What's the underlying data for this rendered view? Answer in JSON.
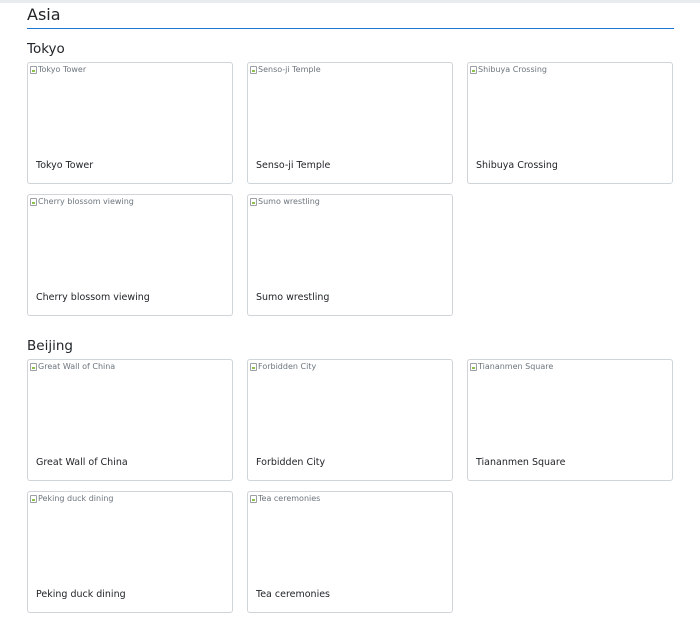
{
  "region": "Asia",
  "cities": [
    {
      "name": "Tokyo",
      "attractions": [
        {
          "title": "Tokyo Tower",
          "alt": "Tokyo Tower"
        },
        {
          "title": "Senso-ji Temple",
          "alt": "Senso-ji Temple"
        },
        {
          "title": "Shibuya Crossing",
          "alt": "Shibuya Crossing"
        },
        {
          "title": "Cherry blossom viewing",
          "alt": "Cherry blossom viewing"
        },
        {
          "title": "Sumo wrestling",
          "alt": "Sumo wrestling"
        }
      ]
    },
    {
      "name": "Beijing",
      "attractions": [
        {
          "title": "Great Wall of China",
          "alt": "Great Wall of China"
        },
        {
          "title": "Forbidden City",
          "alt": "Forbidden City"
        },
        {
          "title": "Tiananmen Square",
          "alt": "Tiananmen Square"
        },
        {
          "title": "Peking duck dining",
          "alt": "Peking duck dining"
        },
        {
          "title": "Tea ceremonies",
          "alt": "Tea ceremonies"
        }
      ]
    }
  ],
  "colors": {
    "heading_rule": "#1976d2",
    "card_border": "#cfd4d9",
    "text": "#212529",
    "alt_text": "#6c757d"
  }
}
